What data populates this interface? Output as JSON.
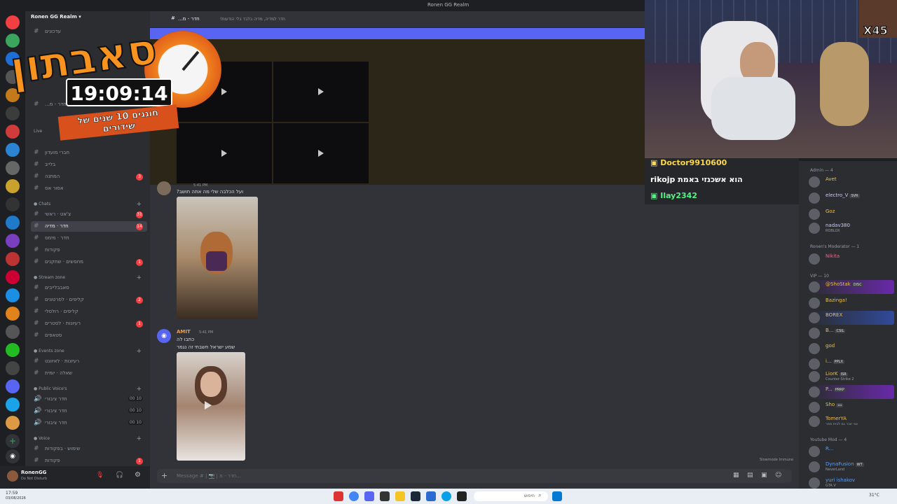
{
  "window": {
    "title": "Ronen GG Realm"
  },
  "server": {
    "name": "Ronen GG Realm"
  },
  "channels": {
    "top": [
      {
        "name": "עדכונים"
      },
      {
        "name": "חדר - מ..."
      }
    ],
    "general": [
      {
        "name": "חברי מועדון"
      },
      {
        "name": "בלייב"
      },
      {
        "name": "המתנה",
        "badge": "3"
      },
      {
        "name": "אסור אס"
      }
    ],
    "chats_label": "Chats",
    "chats": [
      {
        "name": "צ'אט · ראשי",
        "badge": "31"
      },
      {
        "name": "חדר · מדיה",
        "badge": "14",
        "active": true
      },
      {
        "name": "חדר · מימס"
      },
      {
        "name": "פקודות"
      },
      {
        "name": "מחפשים · שחקנים",
        "badge": "1"
      }
    ],
    "stream_label": "Stream zone",
    "stream": [
      {
        "name": "סאבבלייבים"
      },
      {
        "name": "קליפים · לסרטונים",
        "badge": "2"
      },
      {
        "name": "קליפים · רולסלי"
      },
      {
        "name": "רעיונות · לסטרים",
        "badge": "1"
      },
      {
        "name": "סטאפים"
      }
    ],
    "events_label": "Events zone",
    "events": [
      {
        "name": "רעיונות · לאיוונט"
      },
      {
        "name": "שאלה · יומית"
      }
    ],
    "voice_public_label": "Public Voice's",
    "voice_public": [
      {
        "name": "חדר ציבורי",
        "count": "00 10"
      },
      {
        "name": "חדר ציבורי",
        "count": "00 10"
      },
      {
        "name": "חדר ציבורי",
        "count": "00 10"
      }
    ],
    "voice_label": "Voice",
    "voice": [
      {
        "name": "שימוש · בפקודות"
      },
      {
        "name": "פקודות",
        "badge": "1"
      }
    ],
    "live_label": "Live"
  },
  "user": {
    "name": "RonenGG",
    "status": "Do Not Disturb"
  },
  "channel_header": {
    "name": "חדר - מ...",
    "topic": "חדר למדיה, מדיה בלבד בלי הודעות!"
  },
  "messages": [
    {
      "time": "5:41 PM",
      "text": "ועל הכלבה שלי מה אתה חושב?"
    },
    {
      "author": "AMIT",
      "time": "5:41 PM",
      "text1": "כתבו לה",
      "text2": "שמע ישראל חשבתי זה נגמר"
    }
  ],
  "composer": {
    "placeholder": "Message # | 📷 | חדר - מ..."
  },
  "slowmode": "Slowmode Immune",
  "chat_overlay": [
    {
      "user": "Doctor9910600",
      "color": "#ffd84a"
    },
    {
      "user": "rikojp",
      "text": "הוא אשכנזי באמת",
      "color": "#ffffff"
    },
    {
      "user": "Ilay2342",
      "color": "#57f287"
    }
  ],
  "members": {
    "admin_label": "Admin — 4",
    "admin": [
      {
        "name": "Avet",
        "color": "#f0c040"
      },
      {
        "name": "electro_V",
        "tag": "SVR",
        "color": "#c9cdfb"
      },
      {
        "name": "Goz",
        "color": "#f0c040"
      },
      {
        "name": "nadav380",
        "sub": "ROBLOX",
        "color": "#c9cdfb"
      }
    ],
    "mod_label": "Ronen's Moderator — 1",
    "mod": [
      {
        "name": "Nikita",
        "color": "#e86a8a"
      }
    ],
    "vip_label": "VIP — 10",
    "vip": [
      {
        "name": "@ShoStak",
        "tag": "DISC",
        "color": "#f0c040"
      },
      {
        "name": "Bazinga!",
        "color": "#f0c040"
      },
      {
        "name": "BOREX",
        "color": "#f0c040"
      },
      {
        "name": "B...",
        "tag": "CSIL",
        "color": "#f0c040"
      },
      {
        "name": "god",
        "color": "#f0c040"
      },
      {
        "name": "i...",
        "tag": "PPLX",
        "color": "#f0c040"
      },
      {
        "name": "LiorK",
        "tag": "ISR",
        "sub": "Counter-Strike 2",
        "color": "#f0c040"
      },
      {
        "name": "P...",
        "tag": "PRRP",
        "color": "#f0c040"
      },
      {
        "name": "Sho",
        "tag": "גגג",
        "color": "#f0c040"
      },
      {
        "name": "TomerYA",
        "sub": "אני זוכר גם לבית ספר",
        "color": "#f0c040"
      }
    ],
    "yt_label": "Youtube Mod — 4",
    "yt": [
      {
        "name": "R...",
        "color": "#5c9ef5"
      },
      {
        "name": "DynaFusion",
        "tag": "WT",
        "sub": "NeverLand",
        "color": "#5c9ef5"
      },
      {
        "name": "yuri ishakov",
        "sub": "GTA V",
        "color": "#5c9ef5"
      }
    ]
  },
  "overlay": {
    "title": "סאבתון",
    "timer": "19:09:14",
    "subtitle": "חוגגים 10 שנים של שידורים",
    "multiplier": "X45"
  },
  "taskbar": {
    "time": "17:59",
    "date": "03/08/2026",
    "search_placeholder": "חיפוש",
    "weather": "31°C"
  }
}
